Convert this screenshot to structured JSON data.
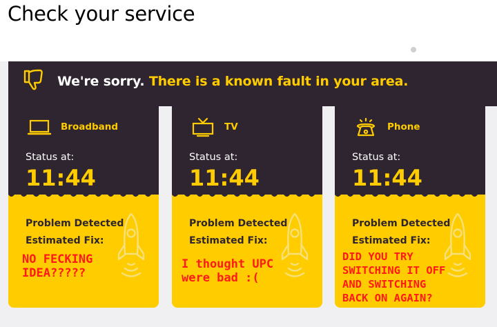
{
  "page": {
    "title": "Check your service"
  },
  "banner": {
    "sorry_text": "We're sorry.",
    "fault_text": "There is a known fault in your area.",
    "icon": "thumbs-down-icon"
  },
  "colors": {
    "dark": "#2f2530",
    "accent": "#ffcc00",
    "scribble": "#ff1a1a"
  },
  "services": [
    {
      "name": "Broadband",
      "icon": "laptop-icon",
      "status_label": "Status at:",
      "time": "11:44",
      "problem": "Problem Detected",
      "fix_label": "Estimated Fix:",
      "scribble": "NO FECKING\nIDEA?????"
    },
    {
      "name": "TV",
      "icon": "tv-icon",
      "status_label": "Status at:",
      "time": "11:44",
      "problem": "Problem Detected",
      "fix_label": "Estimated Fix:",
      "scribble": "I thought UPC\nwere bad :("
    },
    {
      "name": "Phone",
      "icon": "phone-icon",
      "status_label": "Status at:",
      "time": "11:44",
      "problem": "Problem Detected",
      "fix_label": "Estimated Fix:",
      "scribble": "DID YOU TRY\nSWITCHING IT OFF\nAND SWITCHING\nBACK ON AGAIN?"
    }
  ]
}
